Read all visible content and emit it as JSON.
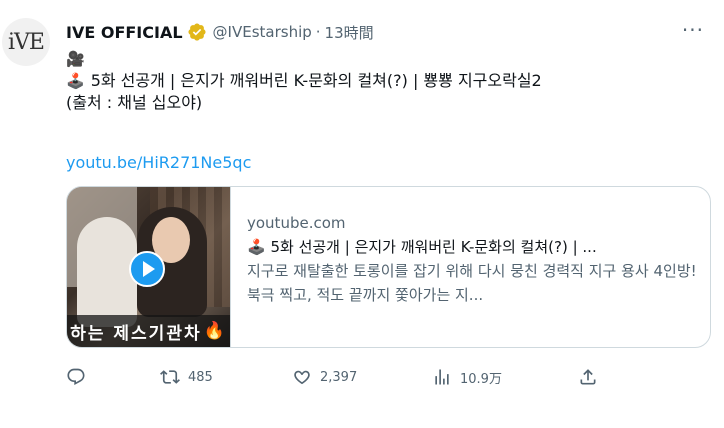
{
  "author": {
    "avatar_text": "iVE",
    "name": "IVE OFFICIAL",
    "handle": "@IVEstarship",
    "separator": "·",
    "time": "13時間",
    "more": "···"
  },
  "tweet": {
    "emoji_camera": "🎥",
    "emoji_joystick": "🕹️",
    "line1": "5화 선공개 | 은지가 깨워버린 K-문화의 컬쳐(?) | 뿅뿅 지구오락실2",
    "line2": "(출처 : 채널 십오야)",
    "link": "youtu.be/HiR271Ne5qc"
  },
  "card": {
    "thumbnail_caption": "하는 제스기관차",
    "thumbnail_flame": "🔥",
    "domain": "youtube.com",
    "emoji_joystick": "🕹️",
    "title": "5화 선공개 | 은지가 깨워버린 K-문화의 컬쳐(?) | ...",
    "description": "지구로 재탈출한 토롱이를 잡기 위해 다시 뭉친 경력직 지구 용사 4인방!북극 찍고, 적도 끝까지 쫓아가는 지..."
  },
  "actions": {
    "reply_icon": "reply-icon",
    "retweet_count": "485",
    "like_count": "2,397",
    "views_count": "10.9万",
    "share_icon": "share-icon"
  },
  "colors": {
    "link": "#1d9bf0",
    "muted": "#536471",
    "verified": "#e2b719"
  }
}
